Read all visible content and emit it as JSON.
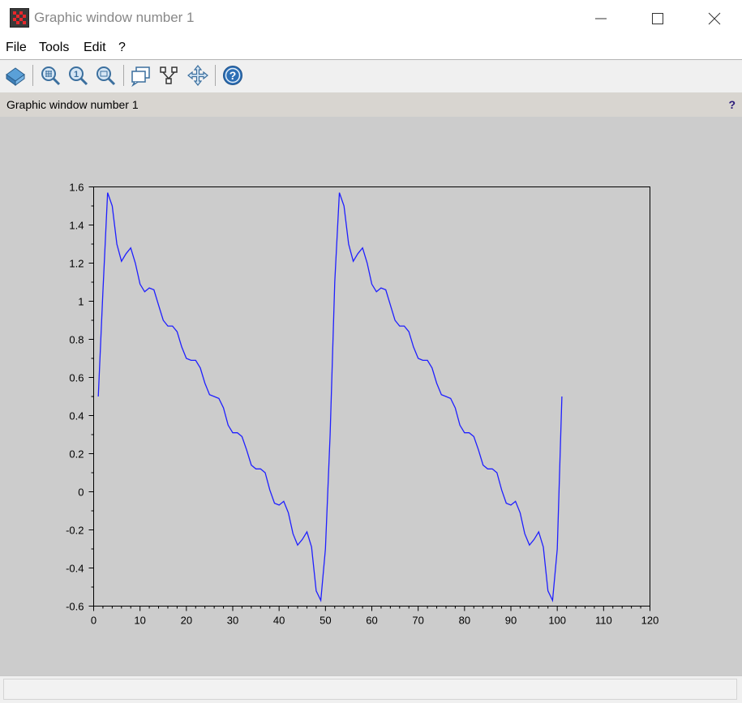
{
  "window": {
    "title": "Graphic window number 1",
    "icon": "scilab-graphic-icon"
  },
  "title_controls": [
    "minimize-icon",
    "maximize-icon",
    "close-icon"
  ],
  "menu": {
    "items": [
      "File",
      "Tools",
      "Edit",
      "?"
    ]
  },
  "toolbar": {
    "buttons": [
      "rotate-3d-icon",
      "zoom-area-icon",
      "zoom-in-icon",
      "zoom-out-icon",
      "datatip-icon",
      "datatip-select-icon",
      "pan-icon",
      "help-icon"
    ]
  },
  "infobar": {
    "label": "Graphic window number 1",
    "help": "?"
  },
  "colors": {
    "line": "#1f1fff",
    "canvas": "#cccccc"
  },
  "chart_data": {
    "type": "line",
    "title": "",
    "xlabel": "",
    "ylabel": "",
    "xlim": [
      0,
      120
    ],
    "ylim": [
      -0.6,
      1.6
    ],
    "xticks": [
      "0",
      "10",
      "20",
      "30",
      "40",
      "50",
      "60",
      "70",
      "80",
      "90",
      "100",
      "110",
      "120"
    ],
    "yticks": [
      "-0.6",
      "-0.4",
      "-0.2",
      "0",
      "0.2",
      "0.4",
      "0.6",
      "0.8",
      "1",
      "1.2",
      "1.4",
      "1.6"
    ],
    "grid": false,
    "series": [
      {
        "x": [
          1,
          2,
          3,
          4,
          5,
          6,
          7,
          8,
          9,
          10,
          11,
          12,
          13,
          14,
          15,
          16,
          17,
          18,
          19,
          20,
          21,
          22,
          23,
          24,
          25,
          26,
          27,
          28,
          29,
          30,
          31,
          32,
          33,
          34,
          35,
          36,
          37,
          38,
          39,
          40,
          41,
          42,
          43,
          44,
          45,
          46,
          47,
          48,
          49,
          50,
          51,
          52,
          53,
          54,
          55,
          56,
          57,
          58,
          59,
          60,
          61,
          62,
          63,
          64,
          65,
          66,
          67,
          68,
          69,
          70,
          71,
          72,
          73,
          74,
          75,
          76,
          77,
          78,
          79,
          80,
          81,
          82,
          83,
          84,
          85,
          86,
          87,
          88,
          89,
          90,
          91,
          92,
          93,
          94,
          95,
          96,
          97,
          98,
          99,
          100,
          101
        ],
        "y": [
          0.5,
          1.05,
          1.57,
          1.5,
          1.3,
          1.21,
          1.25,
          1.28,
          1.2,
          1.09,
          1.05,
          1.07,
          1.06,
          0.98,
          0.9,
          0.87,
          0.87,
          0.84,
          0.76,
          0.7,
          0.69,
          0.69,
          0.65,
          0.57,
          0.51,
          0.5,
          0.49,
          0.44,
          0.35,
          0.31,
          0.31,
          0.29,
          0.22,
          0.14,
          0.12,
          0.12,
          0.1,
          0.01,
          -0.06,
          -0.07,
          -0.05,
          -0.11,
          -0.22,
          -0.28,
          -0.25,
          -0.21,
          -0.29,
          -0.52,
          -0.57,
          -0.3,
          0.3,
          1.1,
          1.57,
          1.5,
          1.3,
          1.21,
          1.25,
          1.28,
          1.2,
          1.09,
          1.05,
          1.07,
          1.06,
          0.98,
          0.9,
          0.87,
          0.87,
          0.84,
          0.76,
          0.7,
          0.69,
          0.69,
          0.65,
          0.57,
          0.51,
          0.5,
          0.49,
          0.44,
          0.35,
          0.31,
          0.31,
          0.29,
          0.22,
          0.14,
          0.12,
          0.12,
          0.1,
          0.01,
          -0.06,
          -0.07,
          -0.05,
          -0.11,
          -0.22,
          -0.28,
          -0.25,
          -0.21,
          -0.29,
          -0.52,
          -0.57,
          -0.3,
          0.5
        ]
      }
    ]
  }
}
